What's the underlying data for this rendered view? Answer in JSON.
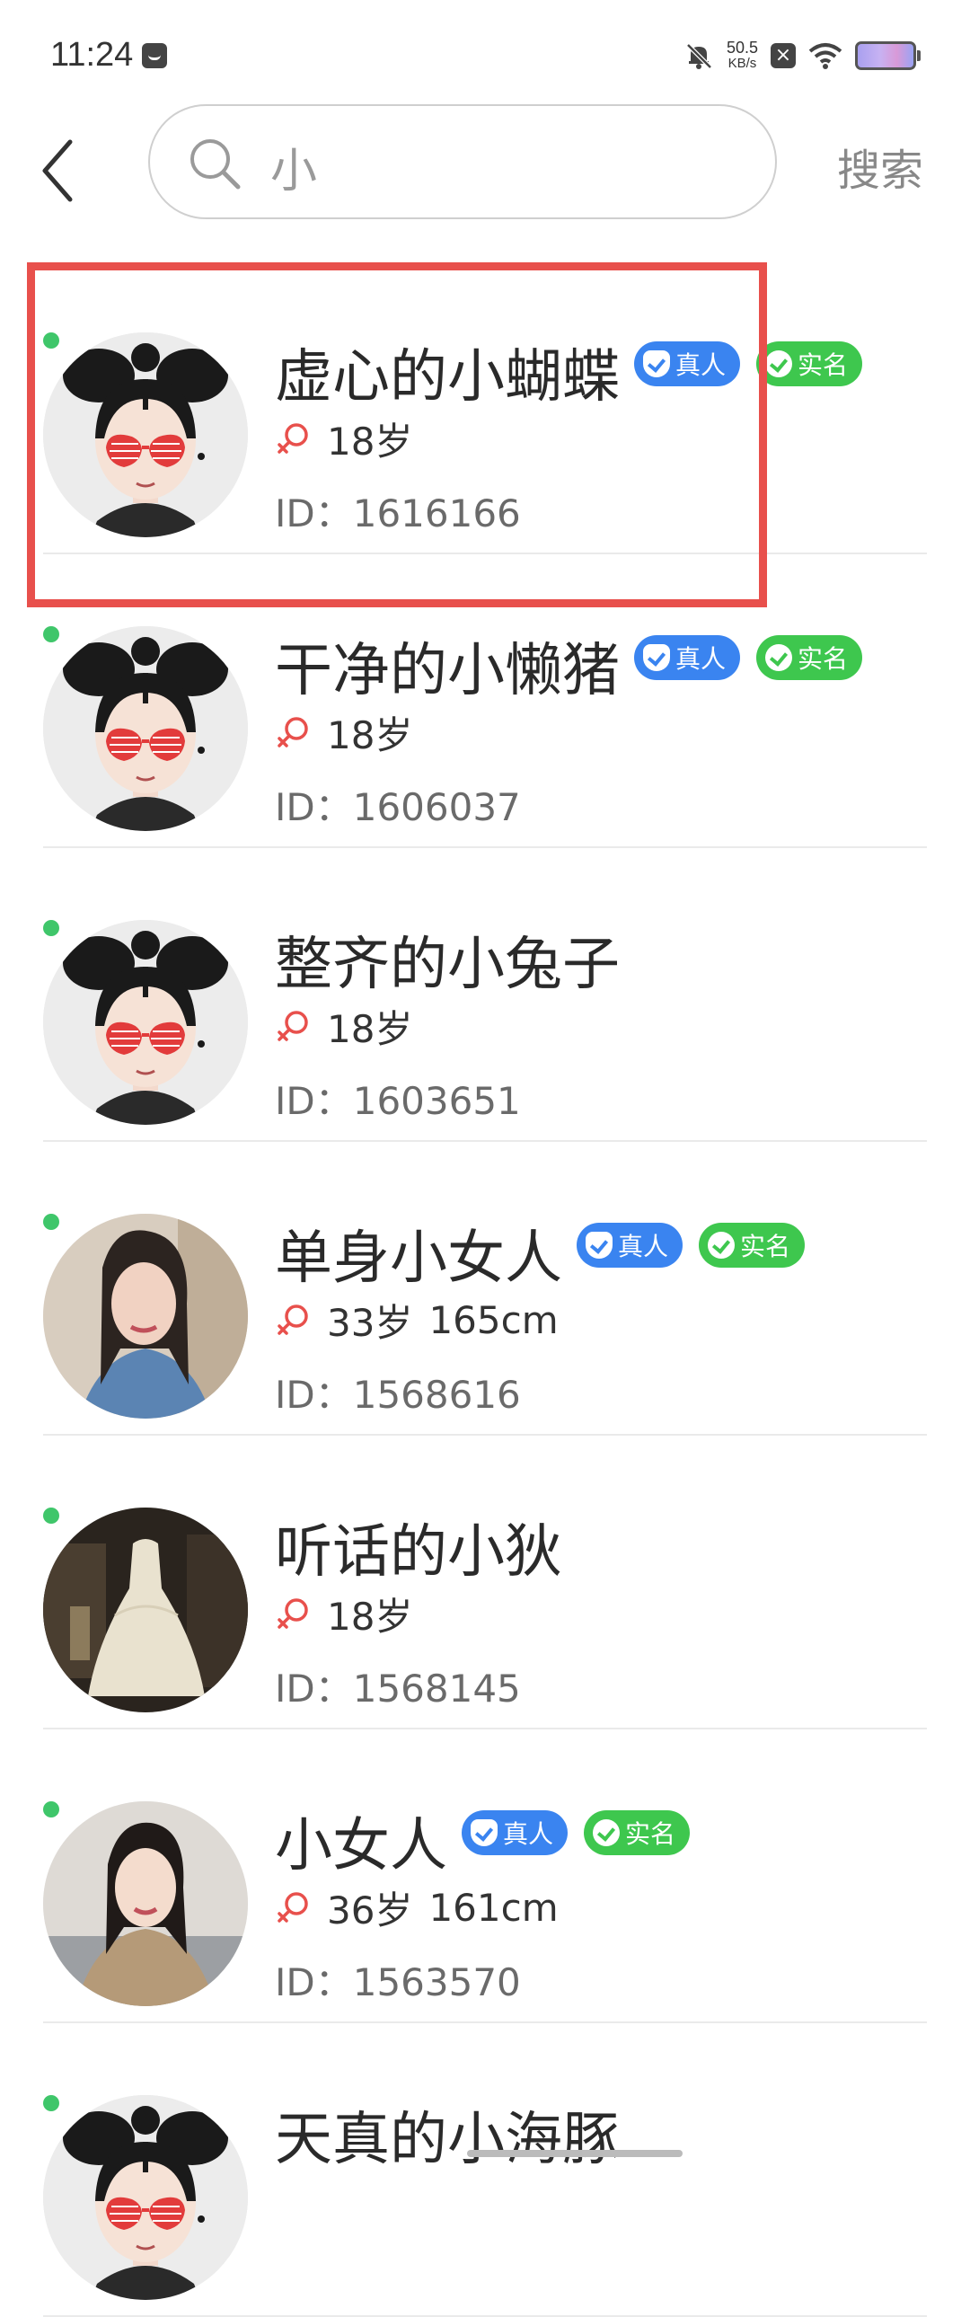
{
  "status": {
    "time": "11:24",
    "speed_value": "50.5",
    "speed_unit": "KB/s"
  },
  "search": {
    "query": "小",
    "button": "搜索"
  },
  "items": [
    {
      "name": "虚心的小蝴蝶",
      "age": "18岁",
      "height": "",
      "id": "ID：1616166",
      "badges": [
        "真人",
        "实名"
      ],
      "online": true,
      "avatar": "cartoon-avatar"
    },
    {
      "name": "干净的小懒猪",
      "age": "18岁",
      "height": "",
      "id": "ID：1606037",
      "badges": [
        "真人",
        "实名"
      ],
      "online": true,
      "avatar": "cartoon-avatar"
    },
    {
      "name": "整齐的小兔子",
      "age": "18岁",
      "height": "",
      "id": "ID：1603651",
      "badges": [],
      "online": true,
      "avatar": "cartoon-avatar"
    },
    {
      "name": "单身小女人",
      "age": "33岁",
      "height": "165cm",
      "id": "ID：1568616",
      "badges": [
        "真人",
        "实名"
      ],
      "online": true,
      "avatar": "photo-woman-blue"
    },
    {
      "name": "听话的小狄",
      "age": "18岁",
      "height": "",
      "id": "ID：1568145",
      "badges": [],
      "online": true,
      "avatar": "photo-wedding-dress"
    },
    {
      "name": "小女人",
      "age": "36岁",
      "height": "161cm",
      "id": "ID：1563570",
      "badges": [
        "真人",
        "实名"
      ],
      "online": true,
      "avatar": "photo-woman-beige"
    },
    {
      "name": "天真的小海豚",
      "age": "",
      "height": "",
      "id": "",
      "badges": [],
      "online": true,
      "avatar": "cartoon-avatar"
    }
  ],
  "colors": {
    "accent_highlight": "#e8504c",
    "online_dot": "#3fc66a",
    "badge_real": "#3a84f0",
    "badge_verified": "#3ec74e",
    "gender_icon": "#e8504c"
  }
}
